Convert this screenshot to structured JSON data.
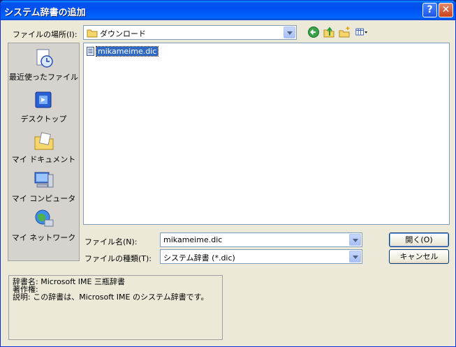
{
  "window": {
    "title": "システム辞書の追加",
    "help_glyph": "?",
    "close_glyph": "✕"
  },
  "location": {
    "label": "ファイルの場所(I):",
    "current": "ダウンロード"
  },
  "toolbar": {
    "icons": [
      "back-icon",
      "up-folder-icon",
      "new-folder-icon",
      "view-menu-icon"
    ]
  },
  "places": [
    {
      "label": "最近使ったファイル",
      "icon": "recent-files-icon"
    },
    {
      "label": "デスクトップ",
      "icon": "desktop-icon"
    },
    {
      "label": "マイ ドキュメント",
      "icon": "my-documents-icon"
    },
    {
      "label": "マイ コンピュータ",
      "icon": "my-computer-icon"
    },
    {
      "label": "マイ ネットワーク",
      "icon": "my-network-icon"
    }
  ],
  "files": [
    {
      "name": "mikameime.dic",
      "selected": true
    }
  ],
  "filename": {
    "label": "ファイル名(N):",
    "value": "mikameime.dic"
  },
  "filetype": {
    "label": "ファイルの種類(T):",
    "value": "システム辞書 (*.dic)"
  },
  "buttons": {
    "open": "開く(O)",
    "cancel": "キャンセル"
  },
  "info": {
    "line1": "辞書名: Microsoft IME 三瓶辞書",
    "line2": "著作権:",
    "line3": "説明: この辞書は、Microsoft IME のシステム辞書です。"
  }
}
